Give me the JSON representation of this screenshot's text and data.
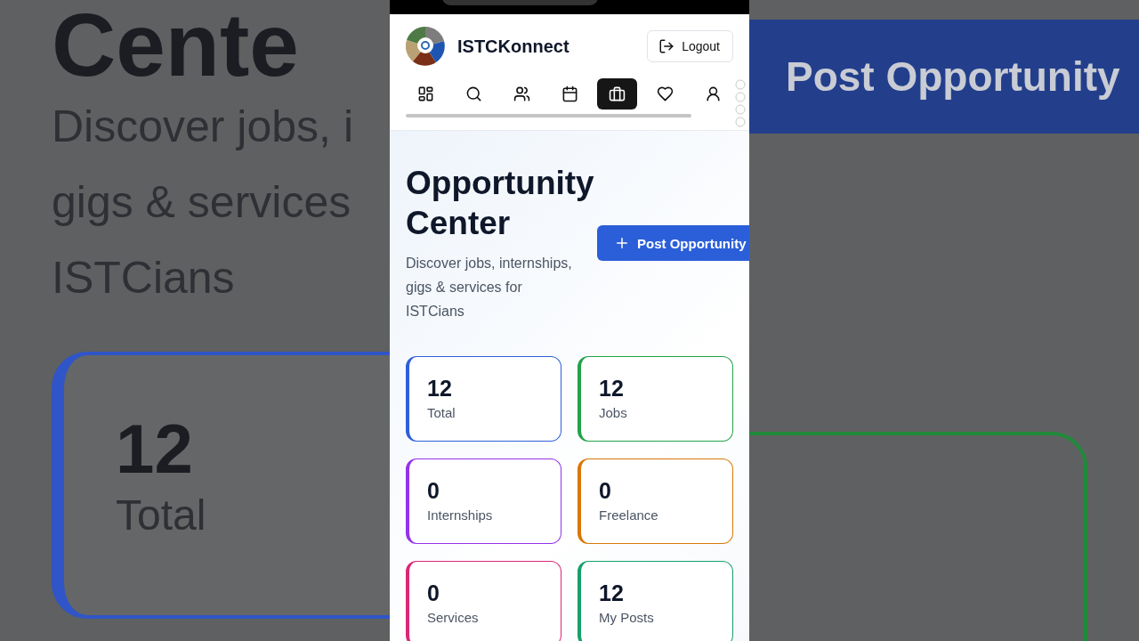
{
  "backdrop": {
    "left": {
      "heading": "Cente",
      "subtitle_lines": [
        "Discover jobs, i",
        "gigs & services",
        "ISTCians"
      ],
      "card": {
        "value": "12",
        "label": "Total",
        "color": "#2f55c8"
      }
    },
    "right": {
      "button": "Post Opportunity",
      "card": {
        "color": "#1f8a3a"
      }
    }
  },
  "header": {
    "title": "ISTCKonnect",
    "logout": "Logout"
  },
  "nav": [
    {
      "kind": "grid",
      "selected": false
    },
    {
      "kind": "search",
      "selected": false
    },
    {
      "kind": "people",
      "selected": false
    },
    {
      "kind": "calendar",
      "selected": false
    },
    {
      "kind": "briefcase",
      "selected": true
    },
    {
      "kind": "heart",
      "selected": false
    },
    {
      "kind": "person",
      "selected": false
    }
  ],
  "page": {
    "title_lines": [
      "Opportunity",
      "Center"
    ],
    "subtitle": "Discover jobs, internships, gigs & services for ISTCians",
    "post_button": "Post Opportunity"
  },
  "stats": [
    {
      "value": "12",
      "label": "Total",
      "color": "#2f5fd8"
    },
    {
      "value": "12",
      "label": "Jobs",
      "color": "#22a24a"
    },
    {
      "value": "0",
      "label": "Internships",
      "color": "#9333ea"
    },
    {
      "value": "0",
      "label": "Freelance",
      "color": "#d97706"
    },
    {
      "value": "0",
      "label": "Services",
      "color": "#db2777"
    },
    {
      "value": "12",
      "label": "My Posts",
      "color": "#16a06a"
    }
  ]
}
